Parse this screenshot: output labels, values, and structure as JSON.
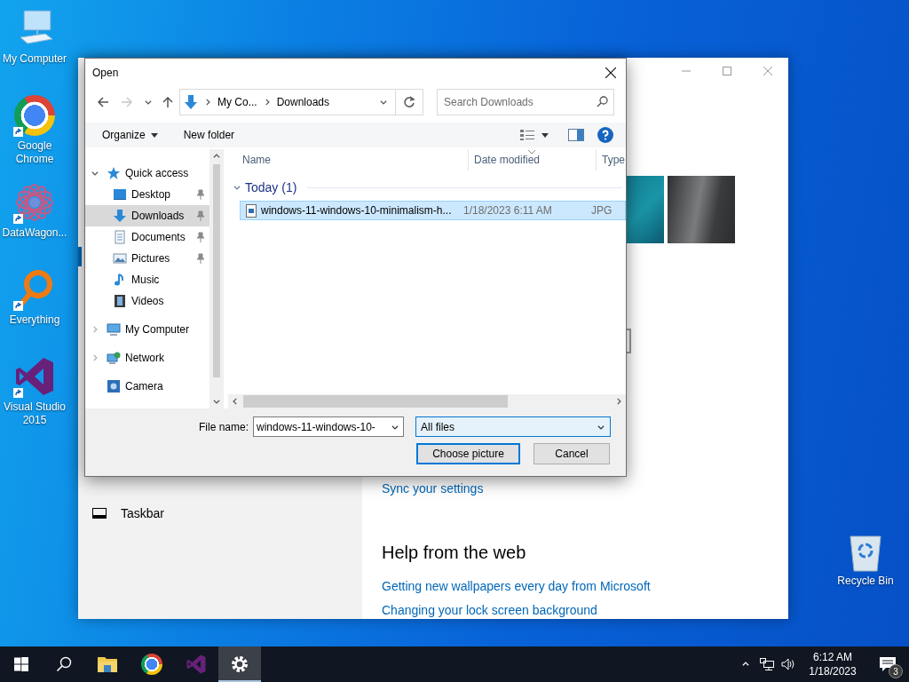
{
  "desktop_icons": [
    {
      "kind": "computer",
      "label": "My Computer",
      "shortcut": false
    },
    {
      "kind": "chrome",
      "label": "Google Chrome",
      "shortcut": true
    },
    {
      "kind": "datawagon",
      "label": "DataWagon...",
      "shortcut": true
    },
    {
      "kind": "everything",
      "label": "Everything",
      "shortcut": true
    },
    {
      "kind": "visualstudio",
      "label": "Visual Studio 2015",
      "shortcut": true
    }
  ],
  "recycle_bin": {
    "label": "Recycle Bin"
  },
  "settings_window": {
    "nav_items": [
      {
        "kind": "taskbar",
        "label": "Taskbar"
      }
    ],
    "sync_link": "Sync your settings",
    "help_heading": "Help from the web",
    "help_links": [
      "Getting new wallpapers every day from Microsoft",
      "Changing your lock screen background"
    ]
  },
  "open_dialog": {
    "title": "Open",
    "nav_buttons": [
      {
        "kind": "back",
        "disabled": false
      },
      {
        "kind": "forward",
        "disabled": true
      },
      {
        "kind": "recent",
        "disabled": false
      },
      {
        "kind": "up",
        "disabled": false
      }
    ],
    "address": [
      "My Co...",
      "Downloads"
    ],
    "search": {
      "placeholder": "Search Downloads"
    },
    "toolbar": {
      "organize": "Organize",
      "new_folder": "New folder"
    },
    "nav_tree": [
      {
        "kind": "star",
        "label": "Quick access",
        "expanded": true,
        "selected": false,
        "children": [
          {
            "kind": "desktop",
            "label": "Desktop",
            "pinned": true,
            "selected": false
          },
          {
            "kind": "downloads",
            "label": "Downloads",
            "pinned": true,
            "selected": true
          },
          {
            "kind": "documents",
            "label": "Documents",
            "pinned": true,
            "selected": false
          },
          {
            "kind": "pictures",
            "label": "Pictures",
            "pinned": true,
            "selected": false
          },
          {
            "kind": "music",
            "label": "Music",
            "pinned": false,
            "selected": false
          },
          {
            "kind": "videos",
            "label": "Videos",
            "pinned": false,
            "selected": false
          }
        ]
      },
      {
        "kind": "computer",
        "label": "My Computer",
        "expanded": false,
        "selected": false
      },
      {
        "kind": "network",
        "label": "Network",
        "expanded": false,
        "selected": false
      },
      {
        "kind": "camera",
        "label": "Camera",
        "selected": false
      }
    ],
    "columns": [
      "Name",
      "Date modified",
      "Type"
    ],
    "groups": [
      {
        "label": "Today (1)",
        "expanded": true,
        "files": [
          {
            "name": "windows-11-windows-10-minimalism-h...",
            "date": "1/18/2023 6:11 AM",
            "type": "JPG",
            "selected": true
          }
        ]
      }
    ],
    "file_name": {
      "label": "File name:",
      "value": "windows-11-windows-10-"
    },
    "file_type": {
      "value": "All files"
    },
    "buttons": [
      {
        "kind": "primary",
        "label": "Choose picture"
      },
      {
        "kind": "secondary",
        "label": "Cancel"
      }
    ]
  },
  "taskbar": {
    "apps": [
      {
        "kind": "start",
        "selected": false
      },
      {
        "kind": "search",
        "selected": false
      },
      {
        "kind": "explorer",
        "selected": false
      },
      {
        "kind": "chrome",
        "selected": false
      },
      {
        "kind": "visualstudio",
        "selected": false
      },
      {
        "kind": "settings",
        "selected": true
      }
    ],
    "clock": {
      "time": "6:12 AM",
      "date": "1/18/2023"
    },
    "notifications": "3"
  }
}
